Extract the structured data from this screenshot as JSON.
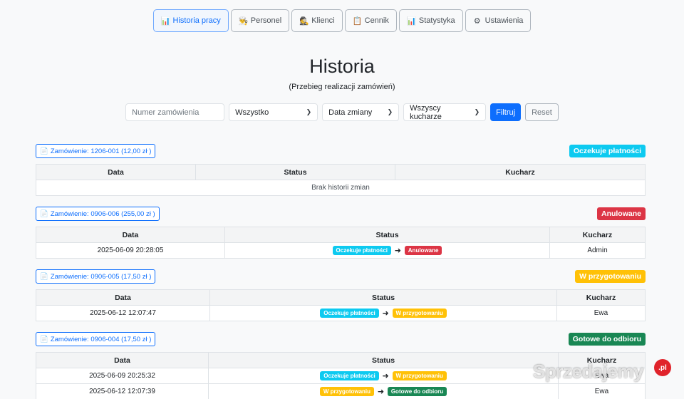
{
  "nav": [
    {
      "label": "Historia pracy",
      "icon": "chart-icon",
      "glyph": "📊",
      "active": true
    },
    {
      "label": "Personel",
      "icon": "staff-icon",
      "glyph": "👨‍🍳",
      "active": false
    },
    {
      "label": "Klienci",
      "icon": "clients-icon",
      "glyph": "🕵",
      "active": false
    },
    {
      "label": "Cennik",
      "icon": "pricelist-icon",
      "glyph": "📋",
      "active": false
    },
    {
      "label": "Statystyka",
      "icon": "stats-icon",
      "glyph": "📊",
      "active": false
    },
    {
      "label": "Ustawienia",
      "icon": "settings-icon",
      "glyph": "⚙",
      "active": false
    }
  ],
  "page": {
    "title": "Historia",
    "subtitle": "(Przebieg realizacji zamówień)"
  },
  "filters": {
    "order_placeholder": "Numer zamówienia",
    "status_select": "Wszystko",
    "date_select": "Data zmiany",
    "cook_select": "Wszyscy kucharze",
    "filter_button": "Filtruj",
    "reset_button": "Reset"
  },
  "table_headers": {
    "date": "Data",
    "status": "Status",
    "cook": "Kucharz"
  },
  "orders": [
    {
      "label": "Zamówienie: 1206-001 (12,00 zł )",
      "status": "Oczekuje płatności",
      "status_color": "#0dcaf0",
      "empty_text": "Brak historii zmian",
      "rows": []
    },
    {
      "label": "Zamówienie: 0906-006 (255,00 zł )",
      "status": "Anulowane",
      "status_color": "#dc3545",
      "rows": [
        {
          "date": "2025-06-09 20:28:05",
          "from": "Oczekuje płatności",
          "from_color": "#0dcaf0",
          "to": "Anulowane",
          "to_color": "#dc3545",
          "cook": "Admin"
        }
      ]
    },
    {
      "label": "Zamówienie: 0906-005 (17,50 zł )",
      "status": "W przygotowaniu",
      "status_color": "#ffc107",
      "rows": [
        {
          "date": "2025-06-12 12:07:47",
          "from": "Oczekuje płatności",
          "from_color": "#0dcaf0",
          "to": "W przygotowaniu",
          "to_color": "#ffc107",
          "cook": "Ewa"
        }
      ]
    },
    {
      "label": "Zamówienie: 0906-004 (17,50 zł )",
      "status": "Gotowe do odbioru",
      "status_color": "#198754",
      "rows": [
        {
          "date": "2025-06-09 20:25:32",
          "from": "Oczekuje płatności",
          "from_color": "#0dcaf0",
          "to": "W przygotowaniu",
          "to_color": "#ffc107",
          "cook": "Ewa"
        },
        {
          "date": "2025-06-12 12:07:39",
          "from": "W przygotowaniu",
          "from_color": "#ffc107",
          "to": "Gotowe do odbioru",
          "to_color": "#198754",
          "cook": "Ewa"
        }
      ]
    }
  ],
  "arrow": "➜",
  "order_icon": "receipt-icon",
  "watermark": {
    "text": "Sprzedajemy",
    "suffix": ".pl"
  }
}
